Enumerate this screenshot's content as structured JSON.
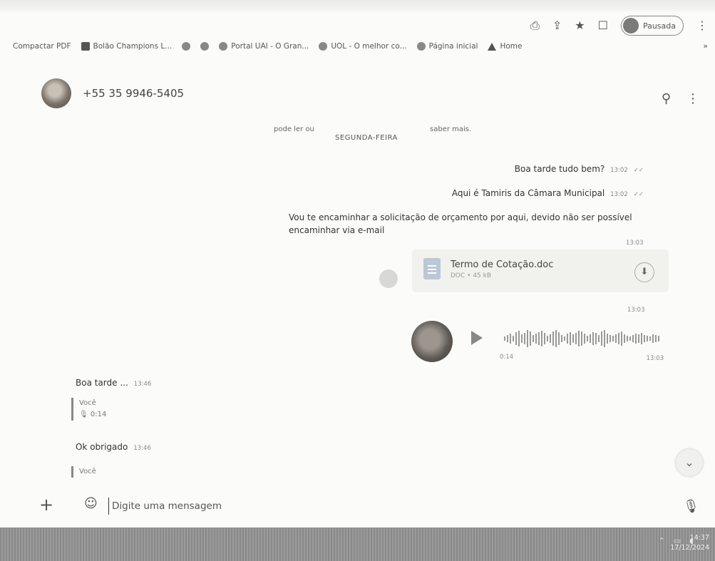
{
  "browser": {
    "profile_label": "Pausada",
    "bookmarks_more": "»",
    "bookmarks": [
      {
        "label": "Compactar PDF",
        "icon": "none"
      },
      {
        "label": "Bolão Champions L...",
        "icon": "square"
      },
      {
        "label": "",
        "icon": "circle"
      },
      {
        "label": "",
        "icon": "circle"
      },
      {
        "label": "Portal UAI - O Gran...",
        "icon": "circle"
      },
      {
        "label": "UOL - O melhor co...",
        "icon": "circle"
      },
      {
        "label": "Página inicial",
        "icon": "circle"
      },
      {
        "label": "Home",
        "icon": "triangle"
      }
    ]
  },
  "chat": {
    "contact": "+55 35 9946-5405",
    "system_left": "pode ler ou",
    "system_day": "SEGUNDA-FEIRA",
    "system_right": "saber mais.",
    "outgoing": [
      {
        "text": "Boa tarde tudo bem?",
        "time": "13:02"
      },
      {
        "text": "Aqui é Tamiris da Câmara Municipal",
        "time": "13:02"
      }
    ],
    "long_message": {
      "text": "Vou te encaminhar a solicitação de orçamento por aqui, devido não ser possível encaminhar via e-mail",
      "time": "13:03"
    },
    "file": {
      "name": "Termo de Cotação.doc",
      "meta": "DOC • 45 kB",
      "time": "13:03"
    },
    "audio": {
      "duration": "0:14",
      "time": "13:03"
    },
    "incoming": [
      {
        "text": "Boa tarde ...",
        "time": "13:46",
        "quote_author": "Você",
        "quote_content": "🎙 0:14"
      },
      {
        "text": "Ok obrigado",
        "time": "13:46",
        "quote_author": "Você"
      }
    ]
  },
  "composer": {
    "placeholder": "Digite uma mensagem"
  },
  "taskbar": {
    "time": "14:37",
    "date": "17/12/2024"
  },
  "waveform": [
    6,
    10,
    14,
    8,
    18,
    22,
    12,
    16,
    24,
    20,
    10,
    14,
    18,
    22,
    16,
    8,
    12,
    20,
    24,
    18,
    10,
    6,
    14,
    18,
    12,
    16,
    22,
    20,
    14,
    8,
    12,
    18,
    16,
    10,
    20,
    24,
    14,
    10,
    8,
    12,
    16,
    20,
    12,
    8,
    6,
    10,
    14,
    12,
    16,
    10,
    8,
    6,
    12,
    10,
    8
  ]
}
